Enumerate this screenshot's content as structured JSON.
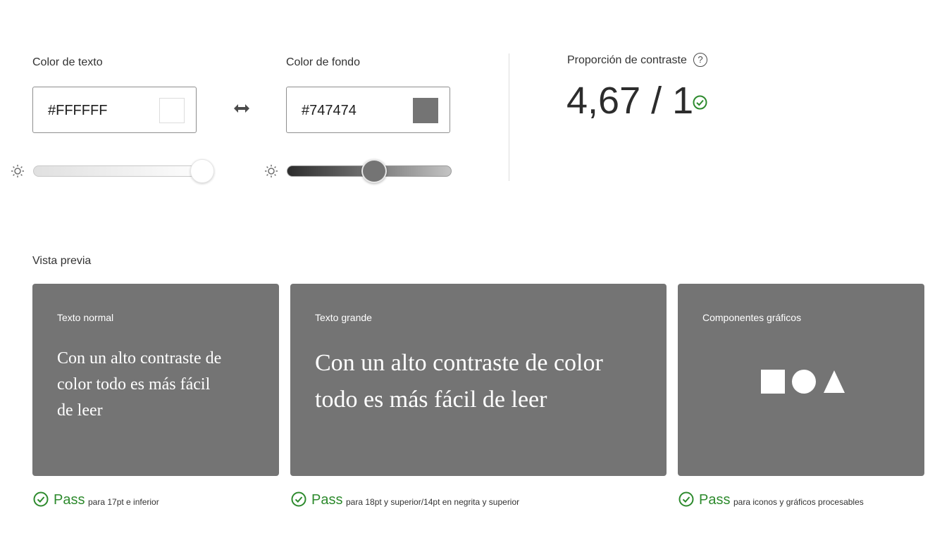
{
  "text_color": {
    "label": "Color de texto",
    "value": "#FFFFFF",
    "swatch": "#ffffff",
    "slider_position": 1.0
  },
  "swap_icon": "swap-arrows-icon",
  "background_color": {
    "label": "Color de fondo",
    "value": "#747474",
    "swatch": "#747474",
    "slider_position": 0.45
  },
  "contrast": {
    "label": "Proporción de contraste",
    "help_glyph": "?",
    "ratio": "4,67 / 1",
    "status_color": "#2d8a2d"
  },
  "preview": {
    "label": "Vista previa",
    "card_color": "#747474",
    "cards": [
      {
        "title": "Texto normal",
        "sample_lines": [
          "Con un alto contraste de",
          "color todo es más fácil",
          "de leer"
        ]
      },
      {
        "title": "Texto grande",
        "sample_lines": [
          "Con un alto contraste de color",
          "todo es más fácil de leer"
        ]
      },
      {
        "title": "Componentes gráficos",
        "shapes": [
          "square-icon",
          "circle-icon",
          "triangle-icon"
        ]
      }
    ]
  },
  "results": [
    {
      "status": "Pass",
      "description": "para 17pt e inferior"
    },
    {
      "status": "Pass",
      "description": "para 18pt y superior/14pt en negrita y superior"
    },
    {
      "status": "Pass",
      "description": "para iconos y gráficos procesables"
    }
  ]
}
